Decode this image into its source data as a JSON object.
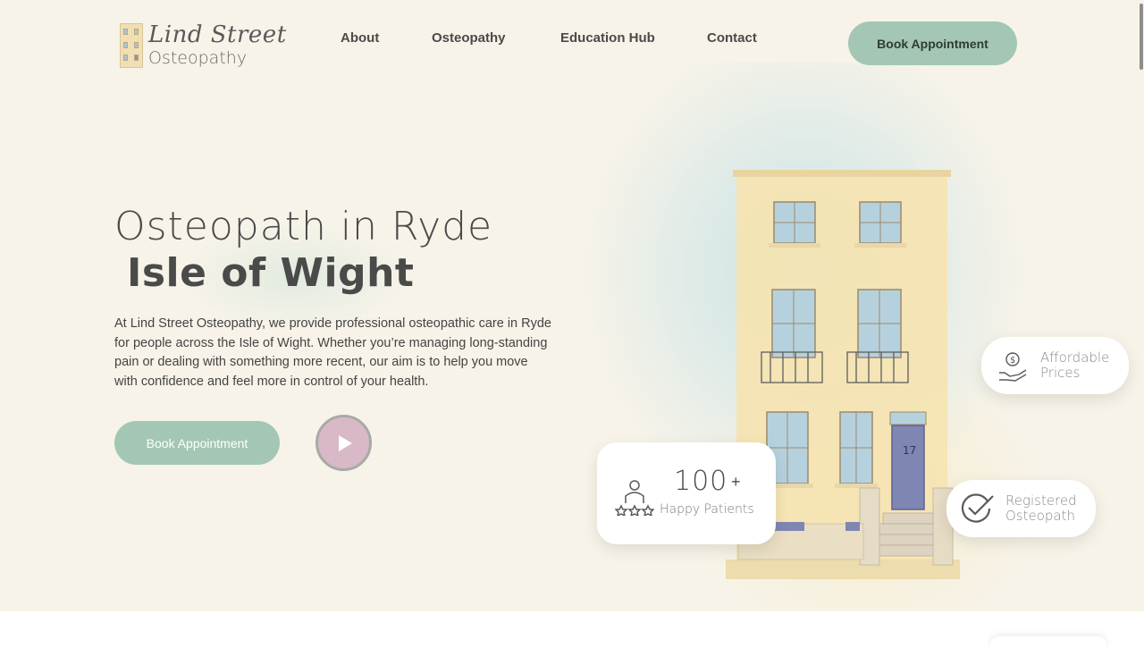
{
  "header": {
    "logo": {
      "line1": "Lind Street",
      "line2": "Osteopathy"
    },
    "nav": [
      {
        "label": "About"
      },
      {
        "label": "Osteopathy"
      },
      {
        "label": "Education Hub"
      },
      {
        "label": "Contact"
      }
    ],
    "book_button": "Book Appointment"
  },
  "hero": {
    "title_line1": "Osteopath in Ryde",
    "title_line2": "Isle of Wight",
    "intro": "At Lind Street Osteopathy, we provide professional osteopathic care in Ryde for people across the Isle of Wight. Whether you’re managing long-standing pain or dealing with something more recent, our aim is to help you move with confidence and feel more in control of your health.",
    "book_button": "Book Appointment",
    "play_button_icon": "play-icon"
  },
  "cards": {
    "patients": {
      "number": "100",
      "suffix": "+",
      "label": "Happy Patients",
      "icon": "patient-stars-icon"
    },
    "prices": {
      "line1": "Affordable",
      "line2": "Prices",
      "icon": "hand-money-icon"
    },
    "registered": {
      "line1": "Registered",
      "line2": "Osteopath",
      "icon": "check-circle-icon"
    },
    "building": {
      "door_number": "17"
    }
  },
  "colors": {
    "accent_green": "#a3c7b4",
    "play_pink": "#d9b8c7",
    "background": "#f7f3e8"
  }
}
